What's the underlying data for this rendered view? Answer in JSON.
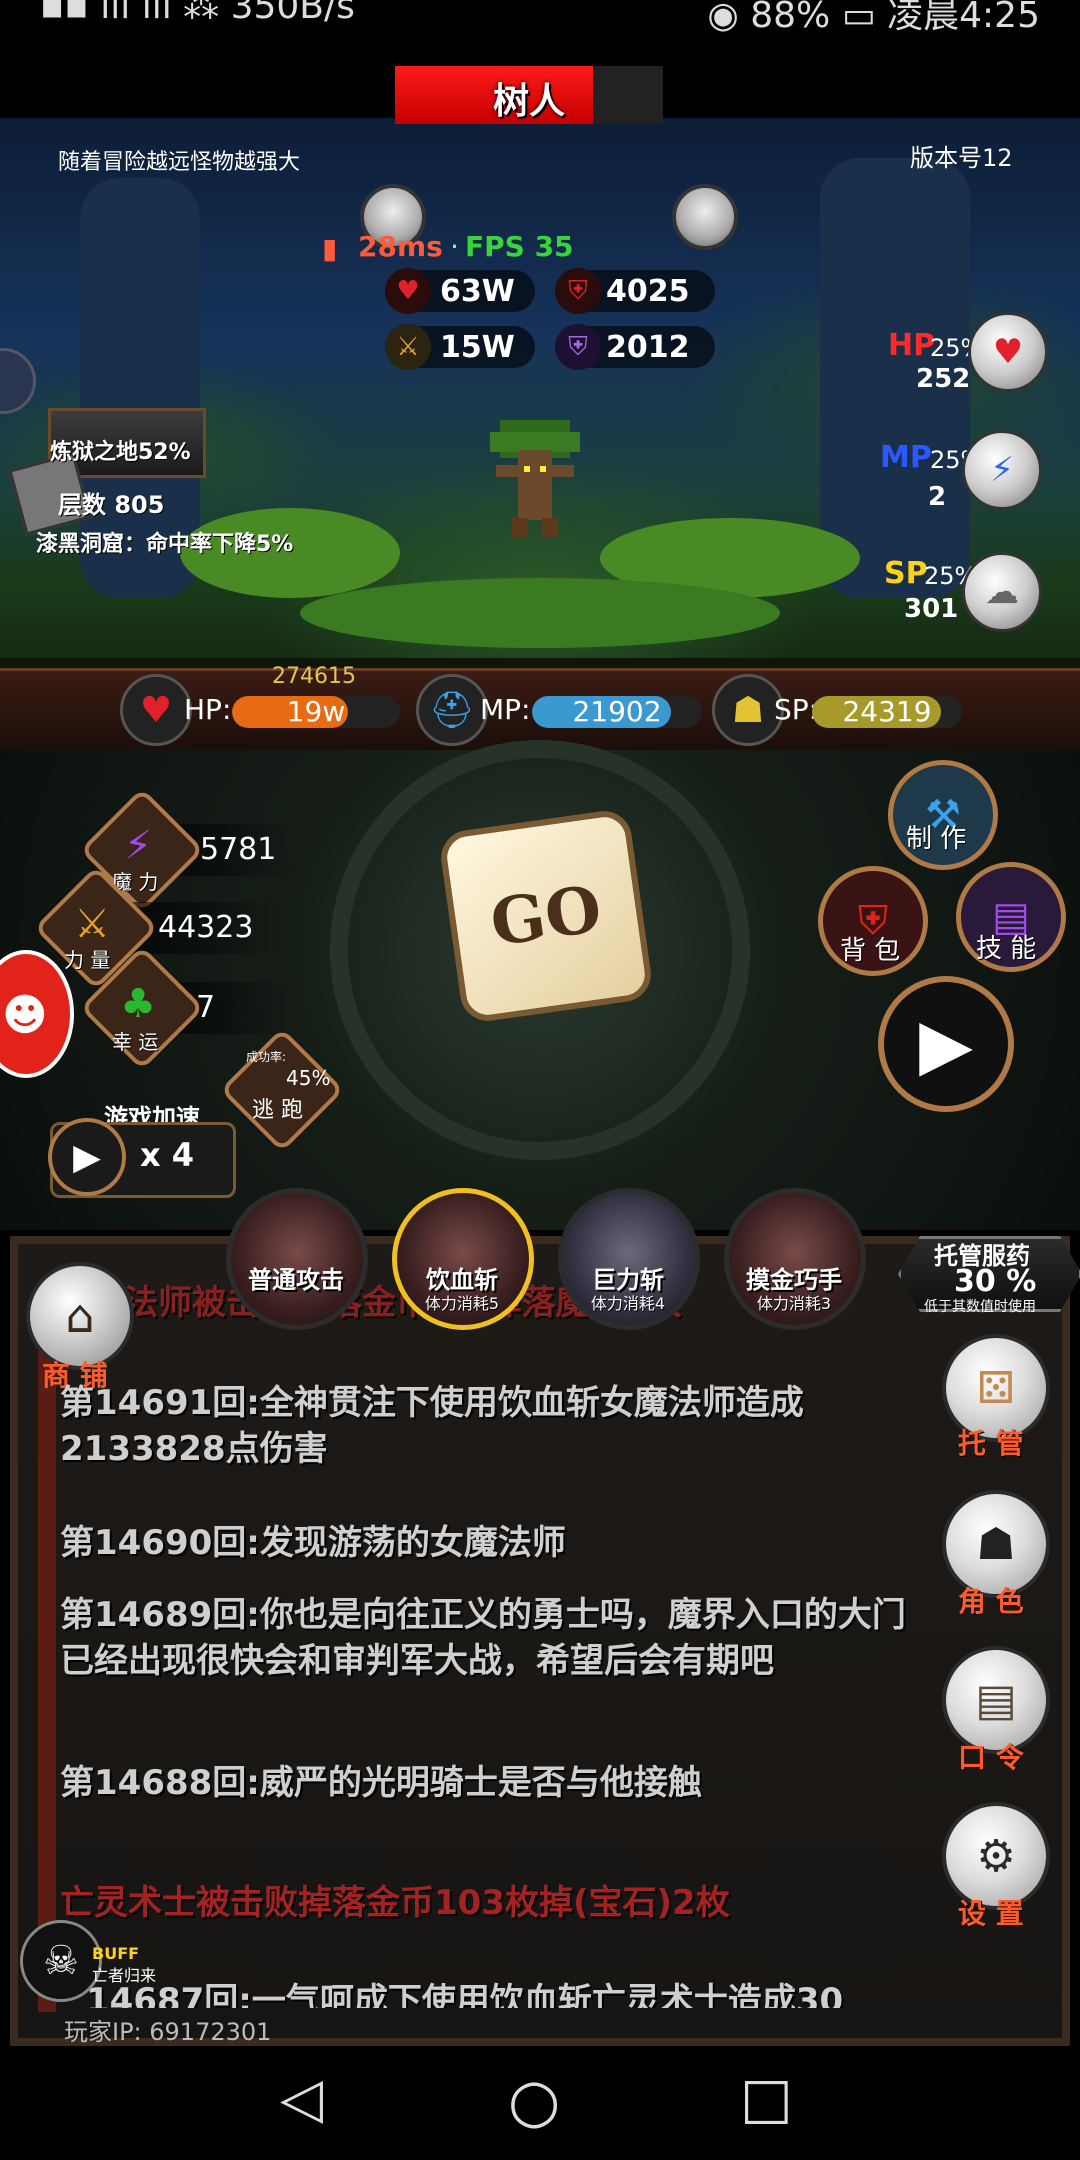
{
  "status_bar": {
    "left": "▪▪ ıll ıll ⁂ 350B/s",
    "right": "◉ 88% ▭ 凌晨4:25"
  },
  "scene": {
    "tip": "随着冒险越远怪物越强大",
    "version": "版本号12",
    "boss_name": "树人",
    "ping": "28ms",
    "fps": "FPS 35",
    "enemy_stats": {
      "hp": "63W",
      "defense": "4025",
      "attack": "15W",
      "magic_defense": "2012"
    },
    "potions": [
      {
        "label": "HP",
        "pct": "25%",
        "count": "252",
        "color": "#ff2a2a"
      },
      {
        "label": "MP",
        "pct": "25%",
        "count": "2",
        "color": "#2a5aff"
      },
      {
        "label": "SP",
        "pct": "25%",
        "count": "301",
        "color": "#ffd21a"
      }
    ],
    "dungeon": "炼狱之地52%",
    "floor": "层数 805",
    "debuff": "漆黑洞窟：命中率下降5%"
  },
  "player_bars": {
    "hp_label": "HP:",
    "hp_max": "274615",
    "hp_value": "19w",
    "hp_fraction": 0.69,
    "mp_label": "MP:",
    "mp_value": "21902",
    "mp_fraction": 0.82,
    "sp_label": "SP:",
    "sp_value": "24319",
    "sp_fraction": 0.86
  },
  "attributes": [
    {
      "label": "魔 力",
      "value": "5781",
      "icon": "lightning-icon"
    },
    {
      "label": "力 量",
      "value": "44323",
      "icon": "sword-icon"
    },
    {
      "label": "幸 运",
      "value": "7",
      "icon": "clover-icon"
    }
  ],
  "escape": {
    "caption": "成功率:",
    "pct": "45%",
    "label": "逃 跑"
  },
  "speed": {
    "label": "游戏加速",
    "value": "x 4"
  },
  "dice_label": "GO",
  "menu": {
    "craft": "制 作",
    "bag": "背 包",
    "skills": "技 能"
  },
  "skills": [
    {
      "name": "普通攻击",
      "cost": ""
    },
    {
      "name": "饮血斩",
      "cost": "体力消耗5"
    },
    {
      "name": "巨力斩",
      "cost": "体力消耗4"
    },
    {
      "name": "摸金巧手",
      "cost": "体力消耗3"
    }
  ],
  "auto_potion": {
    "title": "托管服药",
    "pct": "30 %",
    "note": "低于其数值时使用"
  },
  "shop_label": "商 铺",
  "log": {
    "partial_top": "法师被击败掉落金币3枚掉落魔晶3枚",
    "entries": [
      "第14691回:全神贯注下使用饮血斩女魔法师造成2133828点伤害",
      "第14690回:发现游荡的女魔法师",
      "第14689回:你也是向往正义的勇士吗，魔界入口的大门已经出现很快会和审判军大战，希望后会有期吧",
      "第14688回:威严的光明骑士是否与他接触"
    ],
    "red_entry": "亡灵术士被击败掉落金币103枚掉(宝石)2枚",
    "partial_bottom": "14687回:一气呵成下使用饮血斩亡灵术士造成30"
  },
  "side_buttons": [
    "托 管",
    "角 色",
    "口 令",
    "设 置"
  ],
  "buff": {
    "title": "BUFF",
    "subtitle": "亡者归来"
  },
  "player_ip": "玩家IP:  69172301",
  "nav": {
    "back": "◁",
    "home": "○",
    "recents": "□"
  }
}
